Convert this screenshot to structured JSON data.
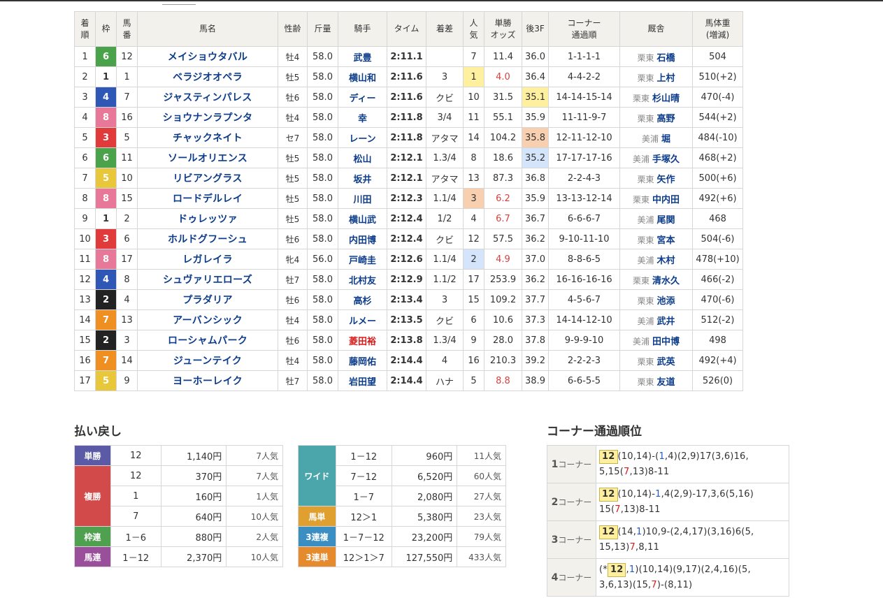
{
  "results": {
    "headers": [
      "着順",
      "枠",
      "馬番",
      "馬名",
      "性齢",
      "斤量",
      "騎手",
      "タイム",
      "着差",
      "人気",
      "単勝オッズ",
      "後3F",
      "コーナー通過順",
      "厩舎",
      "馬体重(増減)"
    ],
    "header_lines": {
      "rank": [
        "着",
        "順"
      ],
      "frame": [
        "枠"
      ],
      "num": [
        "馬",
        "番"
      ],
      "name": [
        "馬名"
      ],
      "sex": [
        "性齢"
      ],
      "kin": [
        "斤量"
      ],
      "jockey": [
        "騎手"
      ],
      "time": [
        "タイム"
      ],
      "margin": [
        "着差"
      ],
      "pop": [
        "人",
        "気"
      ],
      "odds": [
        "単勝",
        "オッズ"
      ],
      "f3": [
        "後3F"
      ],
      "corner": [
        "コーナー",
        "通過順"
      ],
      "stable": [
        "厩舎"
      ],
      "weight": [
        "馬体重",
        "(増減)"
      ]
    },
    "rows": [
      {
        "rank": "1",
        "frame": "6",
        "num": "12",
        "name": "メイショウタバル",
        "sex": "牡4",
        "kin": "58.0",
        "jockey": "武豊",
        "time": "2:11.1",
        "margin": "",
        "pop": "7",
        "odds": "11.4",
        "f3": "36.0",
        "corner": "1-1-1-1",
        "loc": "栗東",
        "trainer": "石橋",
        "weight": "504"
      },
      {
        "rank": "2",
        "frame": "1",
        "num": "1",
        "name": "ベラジオオペラ",
        "sex": "牡5",
        "kin": "58.0",
        "jockey": "横山和",
        "time": "2:11.6",
        "margin": "3",
        "pop": "1",
        "odds": "4.0",
        "f3": "36.4",
        "corner": "4-4-2-2",
        "loc": "栗東",
        "trainer": "上村",
        "weight": "510(+2)"
      },
      {
        "rank": "3",
        "frame": "4",
        "num": "7",
        "name": "ジャスティンパレス",
        "sex": "牡6",
        "kin": "58.0",
        "jockey": "ディー",
        "time": "2:11.6",
        "margin": "クビ",
        "pop": "10",
        "odds": "31.5",
        "f3": "35.1",
        "corner": "14-14-15-14",
        "loc": "栗東",
        "trainer": "杉山晴",
        "weight": "470(-4)"
      },
      {
        "rank": "4",
        "frame": "8",
        "num": "16",
        "name": "ショウナンラプンタ",
        "sex": "牡4",
        "kin": "58.0",
        "jockey": "幸",
        "time": "2:11.8",
        "margin": "3/4",
        "pop": "11",
        "odds": "55.1",
        "f3": "35.9",
        "corner": "11-11-9-7",
        "loc": "栗東",
        "trainer": "高野",
        "weight": "544(+2)"
      },
      {
        "rank": "5",
        "frame": "3",
        "num": "5",
        "name": "チャックネイト",
        "sex": "セ7",
        "kin": "58.0",
        "jockey": "レーン",
        "time": "2:11.8",
        "margin": "アタマ",
        "pop": "14",
        "odds": "104.2",
        "f3": "35.8",
        "corner": "12-11-12-10",
        "loc": "美浦",
        "trainer": "堀",
        "weight": "484(-10)"
      },
      {
        "rank": "6",
        "frame": "6",
        "num": "11",
        "name": "ソールオリエンス",
        "sex": "牡5",
        "kin": "58.0",
        "jockey": "松山",
        "time": "2:12.1",
        "margin": "1.3/4",
        "pop": "8",
        "odds": "18.6",
        "f3": "35.2",
        "corner": "17-17-17-16",
        "loc": "美浦",
        "trainer": "手塚久",
        "weight": "468(+2)"
      },
      {
        "rank": "7",
        "frame": "5",
        "num": "10",
        "name": "リビアングラス",
        "sex": "牡5",
        "kin": "58.0",
        "jockey": "坂井",
        "time": "2:12.1",
        "margin": "アタマ",
        "pop": "13",
        "odds": "87.3",
        "f3": "36.8",
        "corner": "2-2-4-3",
        "loc": "栗東",
        "trainer": "矢作",
        "weight": "500(+6)"
      },
      {
        "rank": "8",
        "frame": "8",
        "num": "15",
        "name": "ロードデルレイ",
        "sex": "牡5",
        "kin": "58.0",
        "jockey": "川田",
        "time": "2:12.3",
        "margin": "1.1/4",
        "pop": "3",
        "odds": "6.2",
        "f3": "35.9",
        "corner": "13-13-12-14",
        "loc": "栗東",
        "trainer": "中内田",
        "weight": "492(+6)"
      },
      {
        "rank": "9",
        "frame": "1",
        "num": "2",
        "name": "ドゥレッツァ",
        "sex": "牡5",
        "kin": "58.0",
        "jockey": "横山武",
        "time": "2:12.4",
        "margin": "1/2",
        "pop": "4",
        "odds": "6.7",
        "f3": "36.7",
        "corner": "6-6-6-7",
        "loc": "美浦",
        "trainer": "尾関",
        "weight": "468"
      },
      {
        "rank": "10",
        "frame": "3",
        "num": "6",
        "name": "ホルドグフーシュ",
        "sex": "牡6",
        "kin": "58.0",
        "jockey": "内田博",
        "time": "2:12.4",
        "margin": "クビ",
        "pop": "12",
        "odds": "57.5",
        "f3": "36.2",
        "corner": "9-10-11-10",
        "loc": "栗東",
        "trainer": "宮本",
        "weight": "504(-6)"
      },
      {
        "rank": "11",
        "frame": "8",
        "num": "17",
        "name": "レガレイラ",
        "sex": "牝4",
        "kin": "56.0",
        "jockey": "戸崎圭",
        "time": "2:12.6",
        "margin": "1.1/4",
        "pop": "2",
        "odds": "4.9",
        "f3": "37.0",
        "corner": "8-8-6-5",
        "loc": "美浦",
        "trainer": "木村",
        "weight": "478(+10)"
      },
      {
        "rank": "12",
        "frame": "4",
        "num": "8",
        "name": "シュヴァリエローズ",
        "sex": "牡7",
        "kin": "58.0",
        "jockey": "北村友",
        "time": "2:12.9",
        "margin": "1.1/2",
        "pop": "17",
        "odds": "253.9",
        "f3": "36.2",
        "corner": "16-16-16-16",
        "loc": "栗東",
        "trainer": "清水久",
        "weight": "466(-2)"
      },
      {
        "rank": "13",
        "frame": "2",
        "num": "4",
        "name": "プラダリア",
        "sex": "牡6",
        "kin": "58.0",
        "jockey": "高杉",
        "time": "2:13.4",
        "margin": "3",
        "pop": "15",
        "odds": "109.2",
        "f3": "37.7",
        "corner": "4-5-6-7",
        "loc": "栗東",
        "trainer": "池添",
        "weight": "470(-6)"
      },
      {
        "rank": "14",
        "frame": "7",
        "num": "13",
        "name": "アーバンシック",
        "sex": "牡4",
        "kin": "58.0",
        "jockey": "ルメー",
        "time": "2:13.5",
        "margin": "クビ",
        "pop": "6",
        "odds": "10.6",
        "f3": "37.3",
        "corner": "14-14-12-10",
        "loc": "美浦",
        "trainer": "武井",
        "weight": "512(-2)"
      },
      {
        "rank": "15",
        "frame": "2",
        "num": "3",
        "name": "ローシャムパーク",
        "sex": "牡6",
        "kin": "58.0",
        "jockey": "菱田裕",
        "time": "2:13.8",
        "margin": "1.3/4",
        "pop": "9",
        "odds": "28.0",
        "f3": "37.8",
        "corner": "9-9-9-10",
        "loc": "美浦",
        "trainer": "田中博",
        "weight": "498"
      },
      {
        "rank": "16",
        "frame": "7",
        "num": "14",
        "name": "ジューンテイク",
        "sex": "牡4",
        "kin": "58.0",
        "jockey": "藤岡佑",
        "time": "2:14.4",
        "margin": "4",
        "pop": "16",
        "odds": "210.3",
        "f3": "39.2",
        "corner": "2-2-2-3",
        "loc": "栗東",
        "trainer": "武英",
        "weight": "492(+4)"
      },
      {
        "rank": "17",
        "frame": "5",
        "num": "9",
        "name": "ヨーホーレイク",
        "sex": "牡7",
        "kin": "58.0",
        "jockey": "岩田望",
        "time": "2:14.4",
        "margin": "ハナ",
        "pop": "5",
        "odds": "8.8",
        "f3": "38.9",
        "corner": "6-6-5-5",
        "loc": "栗東",
        "trainer": "友道",
        "weight": "526(0)"
      }
    ]
  },
  "payout": {
    "title": "払い戻し",
    "left": [
      {
        "label": "単勝",
        "color": "#5a5aa6",
        "entries": [
          {
            "num": "12",
            "yen": "1,140円",
            "ninki": "7人気"
          }
        ]
      },
      {
        "label": "複勝",
        "color": "#d24a4a",
        "entries": [
          {
            "num": "12",
            "yen": "370円",
            "ninki": "7人気"
          },
          {
            "num": "1",
            "yen": "160円",
            "ninki": "1人気"
          },
          {
            "num": "7",
            "yen": "640円",
            "ninki": "10人気"
          }
        ]
      },
      {
        "label": "枠連",
        "color": "#4fa04f",
        "entries": [
          {
            "num": "1－6",
            "yen": "880円",
            "ninki": "2人気"
          }
        ]
      },
      {
        "label": "馬連",
        "color": "#9a4f9a",
        "entries": [
          {
            "num": "1－12",
            "yen": "2,370円",
            "ninki": "10人気"
          }
        ]
      }
    ],
    "right": [
      {
        "label": "ワイド",
        "color": "#4aa6aa",
        "entries": [
          {
            "num": "1－12",
            "yen": "960円",
            "ninki": "11人気"
          },
          {
            "num": "7－12",
            "yen": "6,520円",
            "ninki": "60人気"
          },
          {
            "num": "1－7",
            "yen": "2,080円",
            "ninki": "27人気"
          }
        ]
      },
      {
        "label": "馬単",
        "color": "#e0a030",
        "entries": [
          {
            "num": "12＞1",
            "yen": "5,380円",
            "ninki": "23人気"
          }
        ]
      },
      {
        "label": "3連複",
        "color": "#3a8ec2",
        "entries": [
          {
            "num": "1－7－12",
            "yen": "23,200円",
            "ninki": "79人気"
          }
        ]
      },
      {
        "label": "3連単",
        "color": "#e68a2e",
        "entries": [
          {
            "num": "12＞1＞7",
            "yen": "127,550円",
            "ninki": "433人気"
          }
        ]
      }
    ]
  },
  "corners": {
    "title": "コーナー通過順位",
    "label_suffix": "コーナー",
    "rows": [
      {
        "n": "1",
        "segments": [
          {
            "t": "12",
            "c": "lead"
          },
          {
            "t": "(10,14)-("
          },
          {
            "t": "1",
            "c": "blue"
          },
          {
            "t": ",4)(2,9)17(3,6)16,"
          },
          {
            "t": "\n"
          },
          {
            "t": "5,15("
          },
          {
            "t": "7",
            "c": "red"
          },
          {
            "t": ",13)8-11"
          }
        ]
      },
      {
        "n": "2",
        "segments": [
          {
            "t": "12",
            "c": "lead"
          },
          {
            "t": "(10,14)-"
          },
          {
            "t": "1",
            "c": "blue"
          },
          {
            "t": ",4(2,9)-17,3,6(5,16)"
          },
          {
            "t": "\n"
          },
          {
            "t": "15("
          },
          {
            "t": "7",
            "c": "red"
          },
          {
            "t": ",13)8-11"
          }
        ]
      },
      {
        "n": "3",
        "segments": [
          {
            "t": "12",
            "c": "lead"
          },
          {
            "t": "(14,"
          },
          {
            "t": "1",
            "c": "blue"
          },
          {
            "t": ")10,9-(2,4,17)(3,16)6(5,"
          },
          {
            "t": "\n"
          },
          {
            "t": "15,13)"
          },
          {
            "t": "7",
            "c": "red"
          },
          {
            "t": ",8,11"
          }
        ]
      },
      {
        "n": "4",
        "segments": [
          {
            "t": "(*"
          },
          {
            "t": "12",
            "c": "lead"
          },
          {
            "t": ","
          },
          {
            "t": "1",
            "c": "blue"
          },
          {
            "t": ")(10,14)(9,17)(2,4,16)(5,"
          },
          {
            "t": "\n"
          },
          {
            "t": "3,6,13)(15,"
          },
          {
            "t": "7",
            "c": "red"
          },
          {
            "t": ")-(8,11)"
          }
        ]
      }
    ]
  },
  "colors": {
    "frame_bg": {
      "1": "#ffffff",
      "2": "#222222",
      "3": "#e03a3a",
      "4": "#2f57b5",
      "5": "#e8c83a",
      "6": "#4aa34a",
      "7": "#ef8f22",
      "8": "#e8789a"
    },
    "frame_fg": {
      "1": "#333333",
      "2": "#ffffff",
      "3": "#ffffff",
      "4": "#ffffff",
      "5": "#ffffff",
      "6": "#ffffff",
      "7": "#ffffff",
      "8": "#ffffff"
    }
  },
  "highlights": {
    "pop": {
      "1": "hl-yellow",
      "3": "hl-orange",
      "2": "hl-blue"
    },
    "f3_ranks": {
      "35.1": "hl-yellow",
      "35.8": "hl-orange",
      "35.2": "hl-blue"
    },
    "fav_odds": [
      "4.0",
      "6.2",
      "6.7",
      "4.9",
      "8.8"
    ],
    "red_jockeys": [
      "菱田裕"
    ]
  }
}
